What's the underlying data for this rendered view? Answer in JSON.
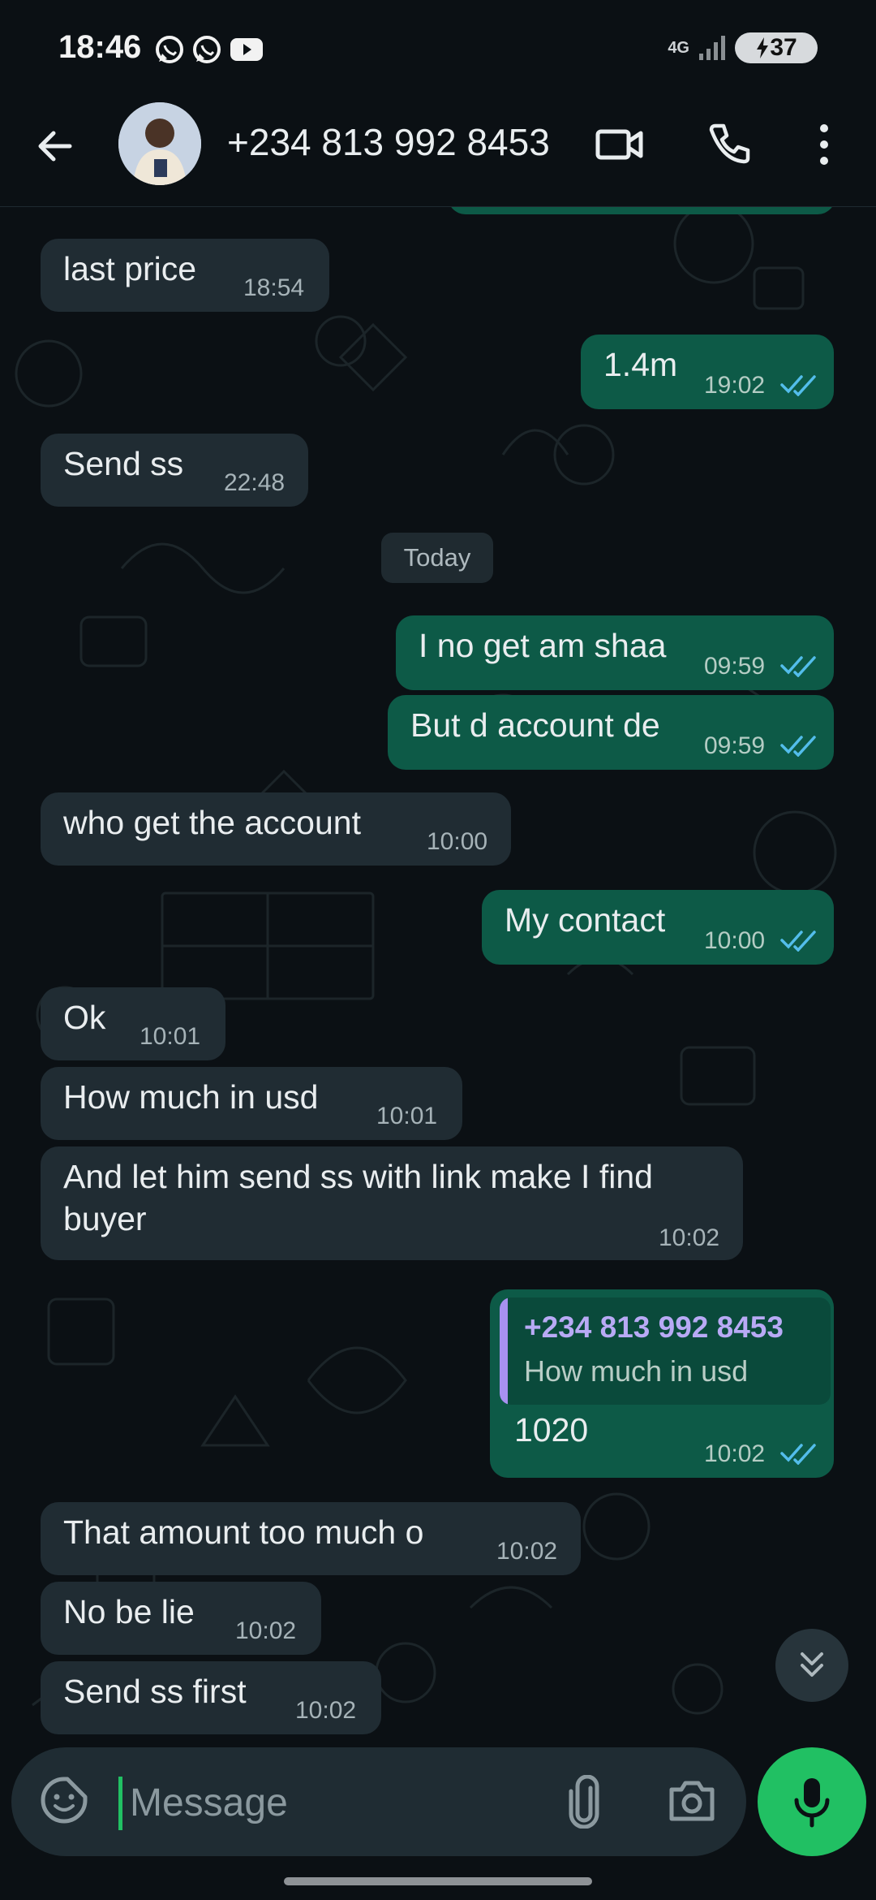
{
  "status_bar": {
    "time": "18:46",
    "network": "4G",
    "battery": "37",
    "icons": [
      "whatsapp-icon",
      "whatsapp-icon",
      "youtube-icon",
      "signal-icon",
      "battery-charging-icon"
    ]
  },
  "header": {
    "contact_name": "+234 813 992 8453",
    "icons": [
      "back-arrow-icon",
      "video-call-icon",
      "voice-call-icon",
      "more-vert-icon"
    ]
  },
  "date_separator": "Today",
  "messages": [
    {
      "direction": "in",
      "text": "last price",
      "time": "18:54"
    },
    {
      "direction": "out",
      "text": "1.4m",
      "time": "19:02",
      "status": "read"
    },
    {
      "direction": "in",
      "text": "Send ss",
      "time": "22:48"
    },
    {
      "direction": "out",
      "text": "I no get am shaa",
      "time": "09:59",
      "status": "read"
    },
    {
      "direction": "out",
      "text": "But d account de",
      "time": "09:59",
      "status": "read"
    },
    {
      "direction": "in",
      "text": "who get the account",
      "time": "10:00"
    },
    {
      "direction": "out",
      "text": "My contact",
      "time": "10:00",
      "status": "read"
    },
    {
      "direction": "in",
      "text": "Ok",
      "time": "10:01"
    },
    {
      "direction": "in",
      "text": "How much in usd",
      "time": "10:01"
    },
    {
      "direction": "in",
      "text_line1": "And let him send ss with link make I find",
      "text_line2": "buyer",
      "time": "10:02"
    },
    {
      "direction": "out",
      "quote_author": "+234 813 992 8453",
      "quote_text": "How much in usd",
      "text": "1020",
      "time": "10:02",
      "status": "read"
    },
    {
      "direction": "in",
      "text": "That amount too much o",
      "time": "10:02"
    },
    {
      "direction": "in",
      "text": "No be lie",
      "time": "10:02"
    },
    {
      "direction": "in",
      "text": "Send ss first",
      "time": "10:02"
    }
  ],
  "composer": {
    "placeholder": "Message",
    "icons": [
      "sticker-icon",
      "attach-icon",
      "camera-icon",
      "mic-icon"
    ]
  },
  "colors": {
    "background": "#0b1014",
    "incoming_bubble": "#202c33",
    "outgoing_bubble": "#0d5a47",
    "read_ticks": "#53bdeb",
    "accent_green": "#21c063",
    "quote_bar": "#a891f0"
  }
}
